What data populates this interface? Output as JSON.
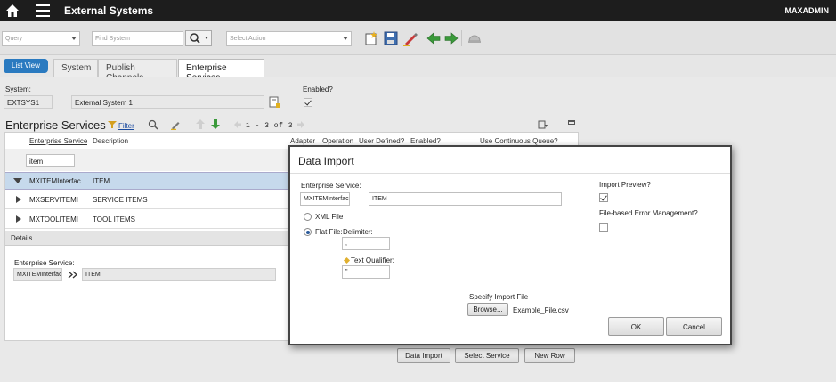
{
  "app": {
    "title": "External Systems",
    "user": "MAXADMIN"
  },
  "toolbar": {
    "query_placeholder": "Query",
    "find_placeholder": "Find System",
    "action_placeholder": "Select Action"
  },
  "tabs": {
    "list_view": "List View",
    "items": [
      "System",
      "Publish Channels",
      "Enterprise Services"
    ]
  },
  "system": {
    "label": "System:",
    "value": "EXTSYS1",
    "description": "External System 1",
    "enabled_label": "Enabled?"
  },
  "services": {
    "title": "Enterprise Services",
    "filter_label": "Filter",
    "pagination": "1 - 3 of 3",
    "columns": [
      "Enterprise Service",
      "Description",
      "Adapter",
      "Operation",
      "User Defined?",
      "Enabled?",
      "Use Continuous Queue?"
    ],
    "filter_value": "item",
    "rows": [
      {
        "service": "MXITEMInterfac",
        "description": "ITEM"
      },
      {
        "service": "MXSERVITEMIr",
        "description": "SERVICE ITEMS"
      },
      {
        "service": "MXTOOLITEMIr",
        "description": "TOOL ITEMS"
      }
    ],
    "details_label": "Details",
    "detail_service_label": "Enterprise Service:",
    "detail_service_value": "MXITEMInterfac",
    "detail_description": "ITEM"
  },
  "buttons": {
    "data_import": "Data Import",
    "select_service": "Select Service",
    "new_row": "New Row"
  },
  "dialog": {
    "title": "Data Import",
    "service_label": "Enterprise Service:",
    "service_value": "MXITEMInterfac",
    "service_description": "ITEM",
    "xml_file": "XML File",
    "flat_file": "Flat File:",
    "delimiter_label": "Delimiter:",
    "delimiter_value": ",",
    "text_qualifier_label": "Text Qualifier:",
    "text_qualifier_value": "\"",
    "import_preview_label": "Import Preview?",
    "file_error_label": "File-based Error Management?",
    "specify_label": "Specify Import File",
    "browse": "Browse...",
    "file_name": "Example_File.csv",
    "ok": "OK",
    "cancel": "Cancel"
  }
}
